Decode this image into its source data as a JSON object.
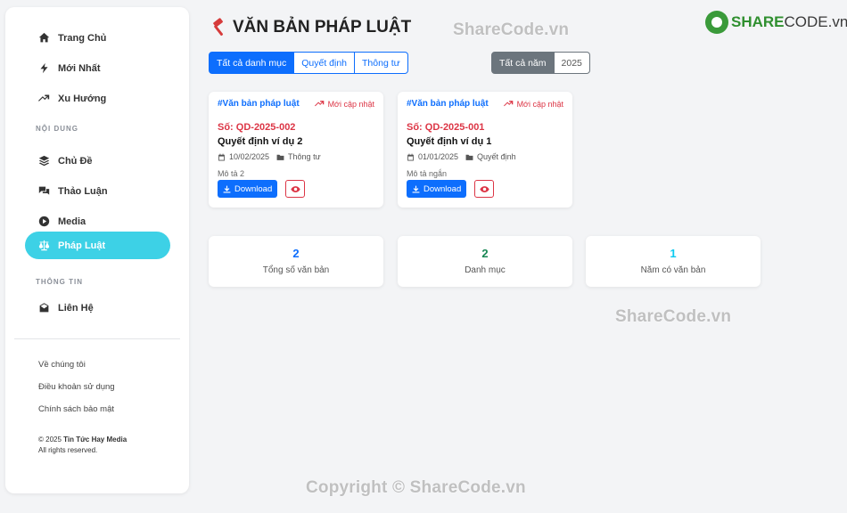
{
  "sidebar": {
    "main_items": [
      {
        "label": "Trang Chủ",
        "icon": "home-icon"
      },
      {
        "label": "Mới Nhất",
        "icon": "bolt-icon"
      },
      {
        "label": "Xu Hướng",
        "icon": "trend-icon"
      }
    ],
    "section_content": "NỘI DUNG",
    "content_items": [
      {
        "label": "Chủ Đề",
        "icon": "layers-icon"
      },
      {
        "label": "Thảo Luận",
        "icon": "comments-icon"
      },
      {
        "label": "Media",
        "icon": "play-icon"
      },
      {
        "label": "Pháp Luật",
        "icon": "scale-icon",
        "active": true
      }
    ],
    "section_info": "THÔNG TIN",
    "info_items": [
      {
        "label": "Liên Hệ",
        "icon": "envelope-icon"
      }
    ],
    "footer_links": [
      "Về chúng tôi",
      "Điều khoản sử dụng",
      "Chính sách bảo mật"
    ],
    "copyright_prefix": "© 2025",
    "copyright_brand": "Tin Tức Hay Media",
    "copyright_rights": "All rights reserved."
  },
  "header": {
    "title": "VĂN BẢN PHÁP LUẬT"
  },
  "filters": {
    "categories": [
      "Tất cả danh mục",
      "Quyết định",
      "Thông tư"
    ],
    "years": [
      "Tất cả năm",
      "2025"
    ]
  },
  "documents": [
    {
      "category": "#Văn bản pháp luật",
      "badge": "Mới cập nhật",
      "number": "Số: QD-2025-002",
      "title": "Quyết định ví dụ 2",
      "date": "10/02/2025",
      "type": "Thông tư",
      "description": "Mô tả 2",
      "download_label": "Download"
    },
    {
      "category": "#Văn bản pháp luật",
      "badge": "Mới cập nhật",
      "number": "Số: QD-2025-001",
      "title": "Quyết định ví dụ 1",
      "date": "01/01/2025",
      "type": "Quyết định",
      "description": "Mô tả ngắn",
      "download_label": "Download"
    }
  ],
  "stats": [
    {
      "value": "2",
      "label": "Tổng số văn bản",
      "color": "#0d6efd"
    },
    {
      "value": "2",
      "label": "Danh mục",
      "color": "#198754"
    },
    {
      "value": "1",
      "label": "Năm có văn bản",
      "color": "#0dcaf0"
    }
  ],
  "watermarks": {
    "logo_brand": "SHARE",
    "logo_suffix": "CODE.vn",
    "top": "ShareCode.vn",
    "middle": "ShareCode.vn",
    "bottom": "Copyright © ShareCode.vn"
  },
  "colors": {
    "primary": "#0d6efd",
    "danger": "#dc3545",
    "active_nav": "#3dd1e6",
    "secondary": "#6c757d"
  }
}
